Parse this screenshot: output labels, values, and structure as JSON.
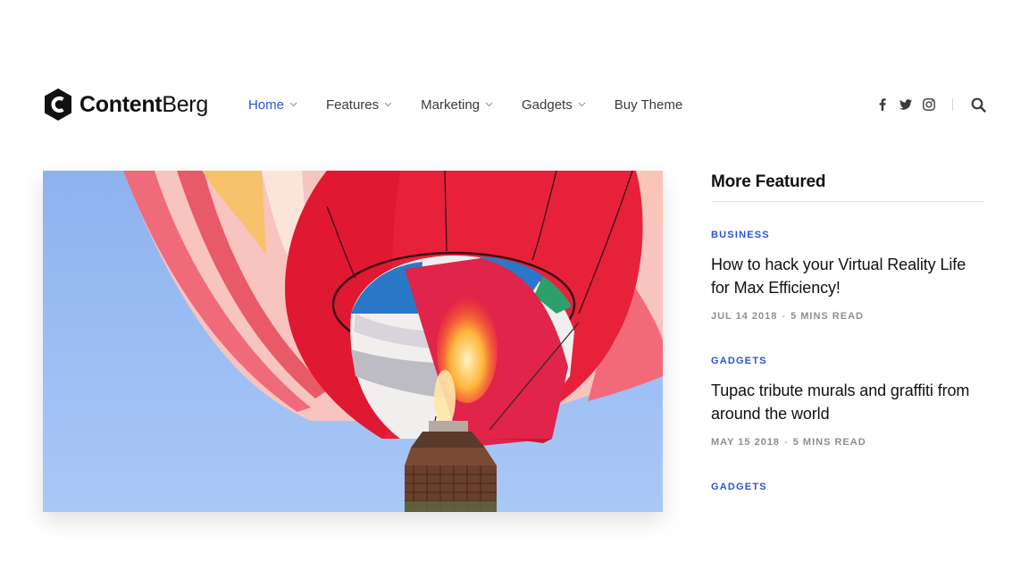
{
  "brand": {
    "name_bold": "Content",
    "name_light": "Berg"
  },
  "nav": {
    "items": [
      {
        "label": "Home",
        "active": true,
        "dropdown": true
      },
      {
        "label": "Features",
        "active": false,
        "dropdown": true
      },
      {
        "label": "Marketing",
        "active": false,
        "dropdown": true
      },
      {
        "label": "Gadgets",
        "active": false,
        "dropdown": true
      },
      {
        "label": "Buy Theme",
        "active": false,
        "dropdown": false
      }
    ]
  },
  "header_icons": [
    "facebook-icon",
    "twitter-icon",
    "instagram-icon",
    "search-icon"
  ],
  "sidebar": {
    "title": "More Featured",
    "posts": [
      {
        "category": "BUSINESS",
        "title": "How to hack your Virtual Reality Life for Max Efficiency!",
        "date": "JUL 14 2018",
        "separator": "-",
        "read_time": "5 MINS READ"
      },
      {
        "category": "GADGETS",
        "title": "Tupac tribute murals and graffiti from around the world",
        "date": "MAY 15 2018",
        "separator": "-",
        "read_time": "5 MINS READ"
      },
      {
        "category": "GADGETS"
      }
    ]
  },
  "colors": {
    "accent": "#2b53d6",
    "text": "#111111",
    "nav_text": "#3a3a3a",
    "meta": "#8e8e8e",
    "sky": "#9cbcf2",
    "balloon_red": "#e8213a"
  }
}
